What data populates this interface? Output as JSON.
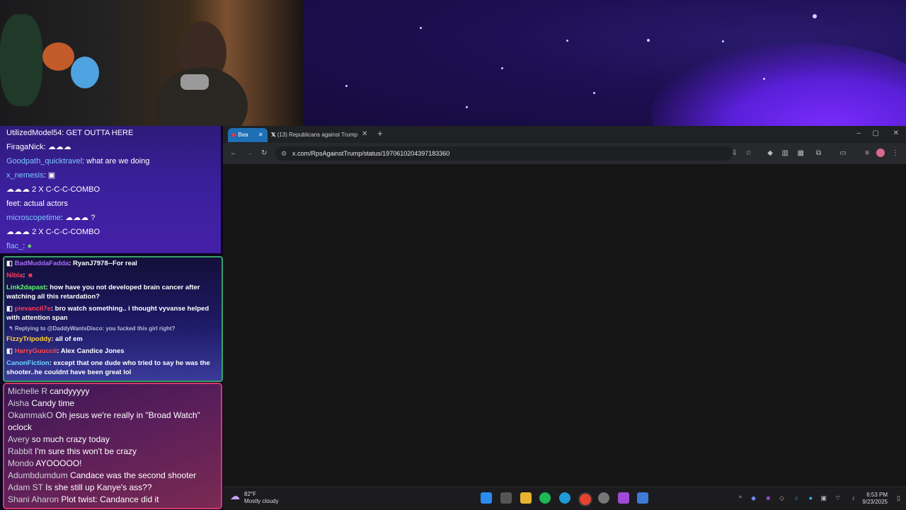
{
  "chat_top": {
    "lines": [
      {
        "user": "UtilizedModel54",
        "sep": ": ",
        "msg": "GET OUTTA HERE"
      },
      {
        "user": "FiragaNick",
        "sep": ": ",
        "msg": ""
      },
      {
        "user": "Goodpath_quicktravel",
        "sep": ": ",
        "msg": "what are we doing"
      },
      {
        "user": "x_nemesis",
        "sep": ": ",
        "msg": ""
      },
      {
        "user": "",
        "sep": "",
        "msg": "2 X C-C-C-COMBO"
      },
      {
        "user": "feet",
        "sep": ": ",
        "msg": "actual actors"
      },
      {
        "user": "microscopetime",
        "sep": ": ",
        "msg": "?"
      },
      {
        "user": "",
        "sep": "",
        "msg": "2 X C-C-C-COMBO"
      },
      {
        "user": "flac_",
        "sep": ": ",
        "msg": ""
      }
    ]
  },
  "chat_mid": {
    "lines": [
      {
        "user": "BadMuddaFadda",
        "color": "#a86bff",
        "msg": "RyanJ7978--For real"
      },
      {
        "user": "Nibla",
        "color": "#ff3b5c",
        "msg": ""
      },
      {
        "user": "Link2dapast",
        "color": "#5cff6a",
        "msg": "how have you not developed brain cancer after watching all this retardation?"
      },
      {
        "user": "pievancil7e",
        "color": "#ff3b5c",
        "msg": "bro watch something.. i thought vyvanse helped with attention span"
      },
      {
        "reply": "Replying to @DaddyWantsDisco: you fucked this girl right?"
      },
      {
        "user": "FizzyTripoddy",
        "color": "#ffd23b",
        "msg": "all of em"
      },
      {
        "user": "HarryGuuccii",
        "color": "#ff4a4a",
        "msg": "Alex Candice Jones"
      },
      {
        "user": "CanonFiction",
        "color": "#6fd4ff",
        "msg": "except that one dude who tried to say he was the shooter..he couldnt have been great lol"
      }
    ]
  },
  "chat_bottom": {
    "lines": [
      {
        "user": "Michelle R",
        "msg": "candyyyyy"
      },
      {
        "user": "Aisha",
        "msg": "Candy time"
      },
      {
        "user": "OkammakO",
        "msg": "Oh jesus we're really in \"Broad Watch\" oclock"
      },
      {
        "user": "Avery",
        "msg": " so much crazy today"
      },
      {
        "user": "Rabbit",
        "msg": "I'm sure this won't be crazy"
      },
      {
        "user": "Mondo",
        "msg": "AYOOOOO!"
      },
      {
        "user": "Adumbdumdum",
        "msg": "Candace was the second shooter"
      },
      {
        "user": "Adam ST",
        "msg": "Is she still up Kanye's ass??"
      },
      {
        "user": "Shani Aharon",
        "msg": "Plot twist: Candance did it"
      }
    ]
  },
  "browser": {
    "tabs": [
      {
        "label": "Bea",
        "active": true
      },
      {
        "label": "(13) Republicans against Trump",
        "active": false
      }
    ],
    "url": "x.com/RpsAgainstTrump/status/1970610204397183360",
    "window_controls": {
      "minimize": "–",
      "maximize": "▢",
      "close": "✕"
    },
    "new_tab": "+"
  },
  "taskbar": {
    "weather_temp": "82°F",
    "weather_desc": "Mostly cloudy",
    "time": "6:53 PM",
    "date": "9/23/2025"
  },
  "colors": {
    "accent": "#1f6fb5",
    "chat_top_bg": "#3a1f9a",
    "chat_mid_border": "#39a06a",
    "chat_bottom_border": "#d23b6a"
  }
}
